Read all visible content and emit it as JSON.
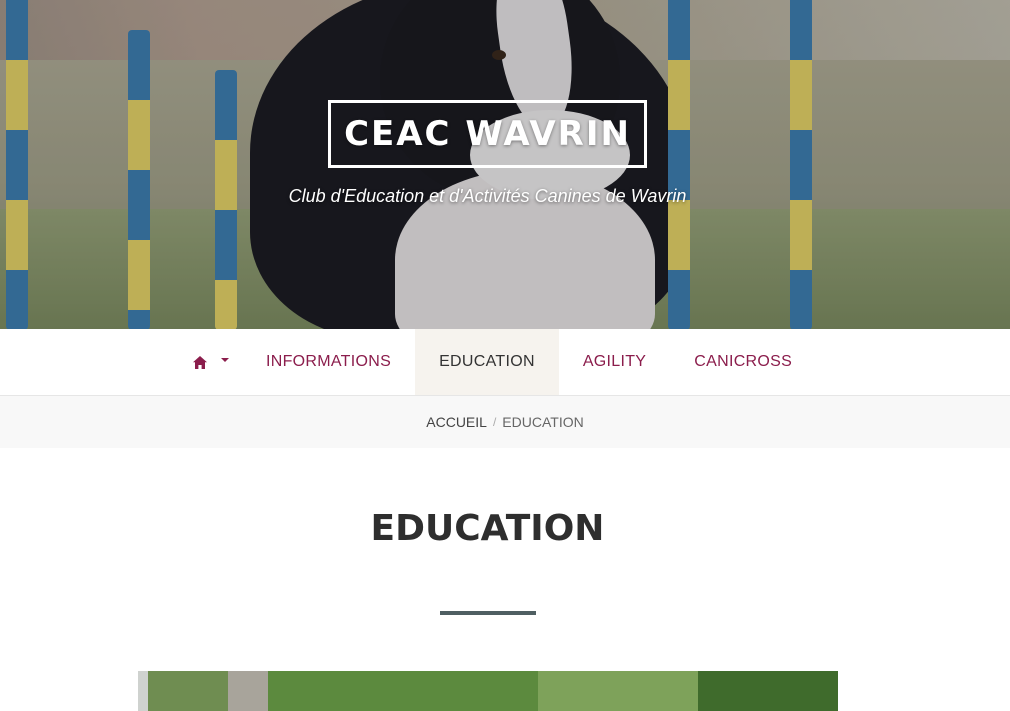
{
  "site": {
    "title": "CEAC WAVRIN",
    "tagline": "Club d'Education et d'Activités Canines de Wavrin"
  },
  "nav": {
    "home_icon": "home-icon",
    "items": [
      {
        "label": "INFORMATIONS",
        "active": false
      },
      {
        "label": "EDUCATION",
        "active": true
      },
      {
        "label": "AGILITY",
        "active": false
      },
      {
        "label": "CANICROSS",
        "active": false
      }
    ]
  },
  "breadcrumb": {
    "home": "ACCUEIL",
    "separator": "/",
    "current": "EDUCATION"
  },
  "page": {
    "title": "EDUCATION"
  },
  "colors": {
    "accent": "#8b1d4c",
    "active_tab_bg": "#f6f3ee",
    "title_rule": "#4f5f62",
    "breadcrumb_bg": "#f8f8f8"
  }
}
